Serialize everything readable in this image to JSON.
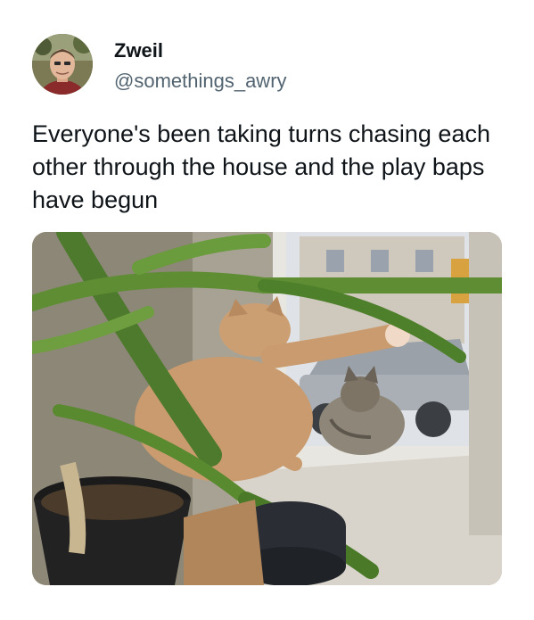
{
  "author": {
    "display_name": "Zweil",
    "handle": "@somethings_awry"
  },
  "tweet": {
    "text": "Everyone's been taking turns chasing each other through the house and the play baps have begun"
  },
  "media": {
    "icon": "photo-cats-playing-by-window"
  }
}
